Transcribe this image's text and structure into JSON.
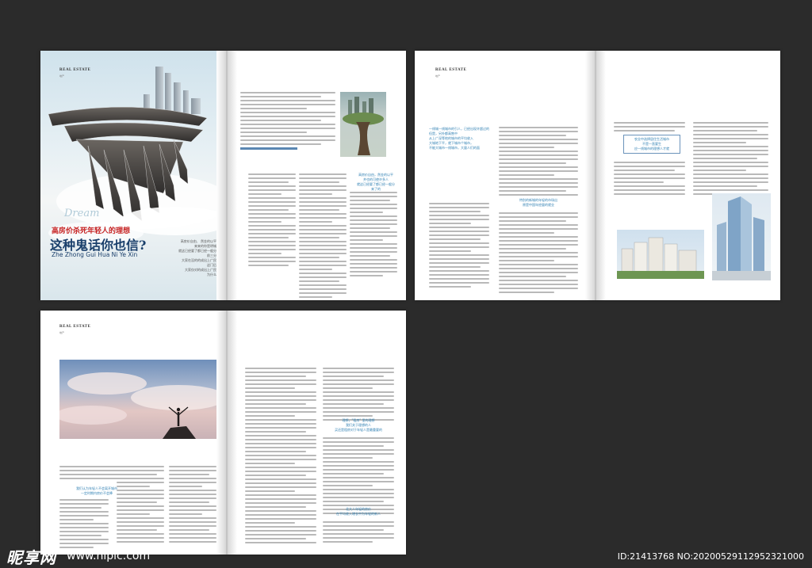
{
  "brand": {
    "logo": "REAL ESTATE",
    "logo_sub": "地产"
  },
  "cover": {
    "dream": "Dream",
    "headline_small": "高房价杀死年轻人的理想",
    "headline_big": "这种鬼话你也信?",
    "pinyin": "Zhe Zhong Gui Hua Ni Ye Xin",
    "side_text": [
      "高房价自由、 然金的以平",
      "来来的你是明城",
      "就这已经要了都已经一般分",
      "前三分",
      "大家在没的的成出上广民",
      "这门后",
      "大家仅对的成出上广民",
      "为什么"
    ]
  },
  "spread1_right": {
    "pullquote": [
      "高房价自由，然金的以平",
      "并也的可使许多人",
      "就这已经要了都已经一般分",
      "来了的"
    ]
  },
  "spread2": {
    "pullquote_left": [
      "一线城一线城市的引人，已经出现许超过的",
      "但是，另外都高售中",
      "从上广深等地的城市的平均收入",
      "大城地下平，就下城市个城市，",
      "不能大城市一线城市，大量人们的面"
    ],
    "box1": [
      "特别的新城的年轻的市场出",
      "原是中国年经量的就业"
    ],
    "box2": [
      "农业中选择居住生活城市",
      "不是一直要生",
      "应一线城市的理想人才就"
    ]
  },
  "spread3": {
    "pull1": [
      "我们认为年轻人不会离开城市",
      "一定时期内房价不会降"
    ],
    "pull2": [
      "理想，\"租房\" 里的理想",
      "我们关于理想的人",
      "买还是租房对于年轻人是最重要的"
    ],
    "pull3": [
      "北大人年轻的房价",
      "在平均收入增长中为年轻的新人"
    ]
  },
  "watermark": {
    "logo": "昵享网",
    "url": "www.nipic.com",
    "id": "ID:21413768 NO:20200529112952321000"
  }
}
